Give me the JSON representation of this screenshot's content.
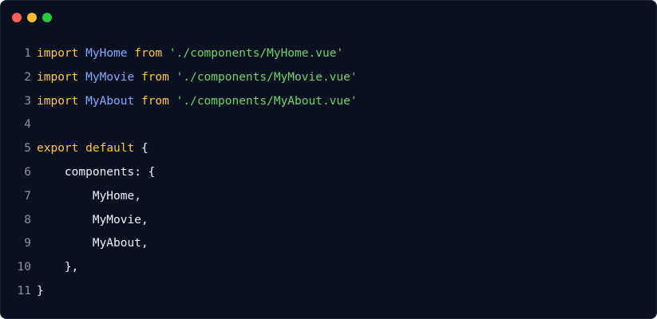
{
  "window": {
    "controls": {
      "close_color": "#ff5f56",
      "minimize_color": "#ffbd2e",
      "maximize_color": "#27c93f"
    }
  },
  "editor": {
    "lines": [
      {
        "number": "1",
        "tokens": [
          {
            "t": "kw",
            "v": "import"
          },
          {
            "t": "pl",
            "v": " "
          },
          {
            "t": "id",
            "v": "MyHome"
          },
          {
            "t": "pl",
            "v": " "
          },
          {
            "t": "kw",
            "v": "from"
          },
          {
            "t": "pl",
            "v": " "
          },
          {
            "t": "str",
            "v": "'./components/MyHome.vue'"
          }
        ]
      },
      {
        "number": "2",
        "tokens": [
          {
            "t": "kw",
            "v": "import"
          },
          {
            "t": "pl",
            "v": " "
          },
          {
            "t": "id",
            "v": "MyMovie"
          },
          {
            "t": "pl",
            "v": " "
          },
          {
            "t": "kw",
            "v": "from"
          },
          {
            "t": "pl",
            "v": " "
          },
          {
            "t": "str",
            "v": "'./components/MyMovie.vue'"
          }
        ]
      },
      {
        "number": "3",
        "tokens": [
          {
            "t": "kw",
            "v": "import"
          },
          {
            "t": "pl",
            "v": " "
          },
          {
            "t": "id",
            "v": "MyAbout"
          },
          {
            "t": "pl",
            "v": " "
          },
          {
            "t": "kw",
            "v": "from"
          },
          {
            "t": "pl",
            "v": " "
          },
          {
            "t": "str",
            "v": "'./components/MyAbout.vue'"
          }
        ]
      },
      {
        "number": "4",
        "tokens": []
      },
      {
        "number": "5",
        "tokens": [
          {
            "t": "kw",
            "v": "export"
          },
          {
            "t": "pl",
            "v": " "
          },
          {
            "t": "kw",
            "v": "default"
          },
          {
            "t": "pl",
            "v": " {"
          }
        ]
      },
      {
        "number": "6",
        "tokens": [
          {
            "t": "pl",
            "v": "    components: {"
          }
        ]
      },
      {
        "number": "7",
        "tokens": [
          {
            "t": "pl",
            "v": "        MyHome,"
          }
        ]
      },
      {
        "number": "8",
        "tokens": [
          {
            "t": "pl",
            "v": "        MyMovie,"
          }
        ]
      },
      {
        "number": "9",
        "tokens": [
          {
            "t": "pl",
            "v": "        MyAbout,"
          }
        ]
      },
      {
        "number": "10",
        "tokens": [
          {
            "t": "pl",
            "v": "    },"
          }
        ]
      },
      {
        "number": "11",
        "tokens": [
          {
            "t": "pl",
            "v": "}"
          }
        ]
      }
    ]
  }
}
